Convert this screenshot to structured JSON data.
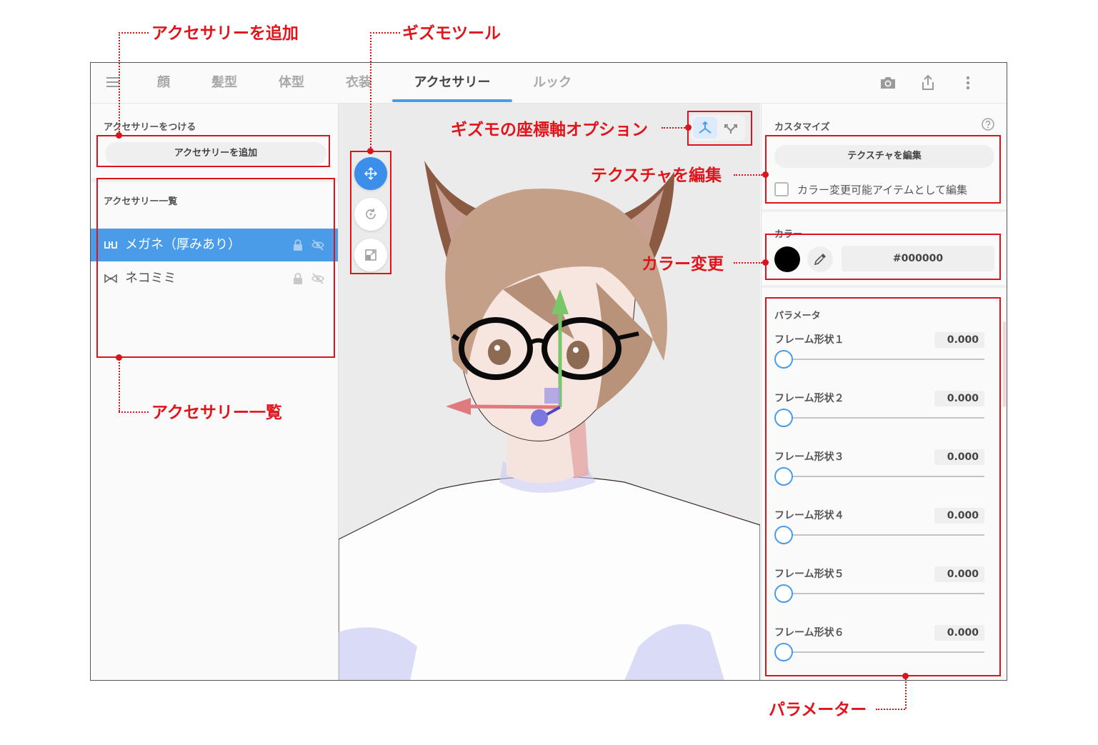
{
  "tabs": [
    {
      "label": "顔",
      "active": false
    },
    {
      "label": "髪型",
      "active": false
    },
    {
      "label": "体型",
      "active": false
    },
    {
      "label": "衣装",
      "active": false
    },
    {
      "label": "アクセサリー",
      "active": true
    },
    {
      "label": "ルック",
      "active": false
    }
  ],
  "header_icons": [
    "menu-icon",
    "camera-icon",
    "share-icon",
    "more-vert-icon"
  ],
  "left": {
    "attach_label": "アクセサリーをつける",
    "add_button": "アクセサリーを追加",
    "list_label": "アクセサリー一覧",
    "items": [
      {
        "label": "メガネ（厚みあり）",
        "icon": "glasses-icon",
        "selected": true
      },
      {
        "label": "ネコミミ",
        "icon": "bowtie-icon",
        "selected": false
      }
    ]
  },
  "viewport": {
    "gizmo_tools": [
      "move-icon",
      "rotate-icon",
      "scale-icon"
    ],
    "active_gizmo": "move",
    "axis_options": [
      "global-axis-icon",
      "local-axis-icon"
    ],
    "active_axis": "global"
  },
  "right": {
    "customize_label": "カスタマイズ",
    "edit_texture_button": "テクスチャを編集",
    "color_editable_checkbox": "カラー変更可能アイテムとして編集",
    "color_label": "カラー",
    "color_value": "#000000",
    "params_label": "パラメータ",
    "params": [
      {
        "label": "フレーム形状１",
        "value": "0.000"
      },
      {
        "label": "フレーム形状２",
        "value": "0.000"
      },
      {
        "label": "フレーム形状３",
        "value": "0.000"
      },
      {
        "label": "フレーム形状４",
        "value": "0.000"
      },
      {
        "label": "フレーム形状５",
        "value": "0.000"
      },
      {
        "label": "フレーム形状６",
        "value": "0.000"
      }
    ]
  },
  "annotations": {
    "add_accessory": "アクセサリーを追加",
    "gizmo_tools": "ギズモツール",
    "gizmo_axis": "ギズモの座標軸オプション",
    "edit_texture": "テクスチャを編集",
    "color_change": "カラー変更",
    "accessory_list": "アクセサリー一覧",
    "parameters": "パラメーター"
  },
  "colors": {
    "accent": "#4a9be8",
    "annotation": "#e0141b",
    "selected_color": "#000000"
  }
}
